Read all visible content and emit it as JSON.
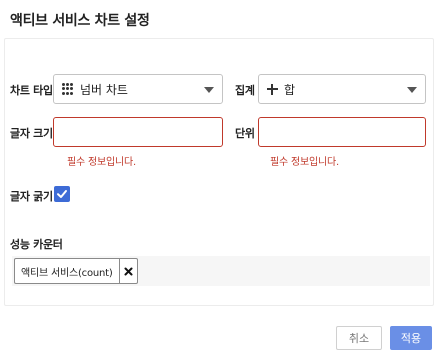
{
  "dialog": {
    "title": "액티브 서비스 차트 설정"
  },
  "form": {
    "chart_type": {
      "label": "차트 타입",
      "value": "넘버 차트",
      "icon": "grid-dots-icon"
    },
    "aggregate": {
      "label": "집계",
      "value": "합",
      "icon": "plus-icon"
    },
    "font_size": {
      "label": "글자 크기",
      "value": "",
      "error": "필수 정보입니다."
    },
    "unit": {
      "label": "단위",
      "value": "",
      "error": "필수 정보입니다."
    },
    "bold": {
      "label": "글자 굵기",
      "checked": true
    },
    "counter": {
      "label": "성능 카운터",
      "chips": [
        {
          "text": "액티브 서비스(count)"
        }
      ]
    }
  },
  "buttons": {
    "cancel": "취소",
    "apply": "적용"
  },
  "colors": {
    "error": "#c0392b",
    "primary": "#3d6bd6",
    "apply_button": "#6a8fe6"
  }
}
